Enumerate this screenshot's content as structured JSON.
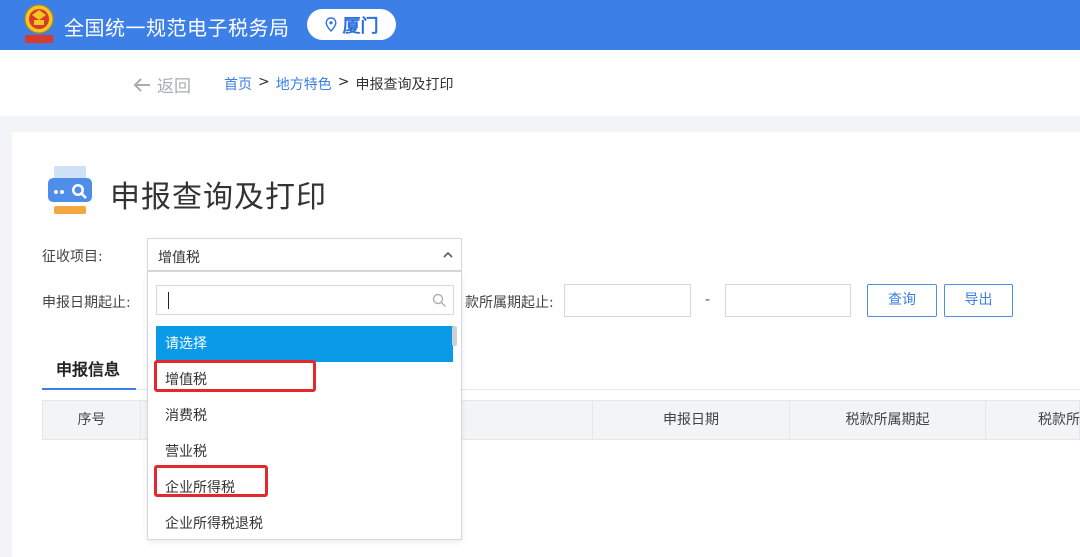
{
  "header": {
    "emblem_text": "国家税务总局",
    "app_title": "全国统一规范电子税务局",
    "city": "厦门",
    "brand_color": "#3c7fe6"
  },
  "nav": {
    "back_label": "返回",
    "breadcrumb": [
      "首页",
      "地方特色",
      "申报查询及打印"
    ],
    "separator": ">"
  },
  "page": {
    "title": "申报查询及打印",
    "icon": "printer-search-icon"
  },
  "form": {
    "collection_item_label": "征收项目:",
    "collection_item_value": "增值税",
    "declare_date_label": "申报日期起止:",
    "tax_period_label": "款所属期起止:",
    "range_separator": "-",
    "query_button": "查询",
    "export_button": "导出"
  },
  "dropdown": {
    "search_value": "",
    "options": [
      "请选择",
      "增值税",
      "消费税",
      "营业税",
      "企业所得税",
      "企业所得税退税"
    ],
    "selected_index": 0,
    "highlighted": [
      "增值税",
      "企业所得税"
    ],
    "highlight_color": "#e3282e"
  },
  "tabs": {
    "active": "申报信息"
  },
  "table": {
    "headers": [
      "序号",
      "申报日期",
      "税款所属期起",
      "税款所"
    ]
  }
}
